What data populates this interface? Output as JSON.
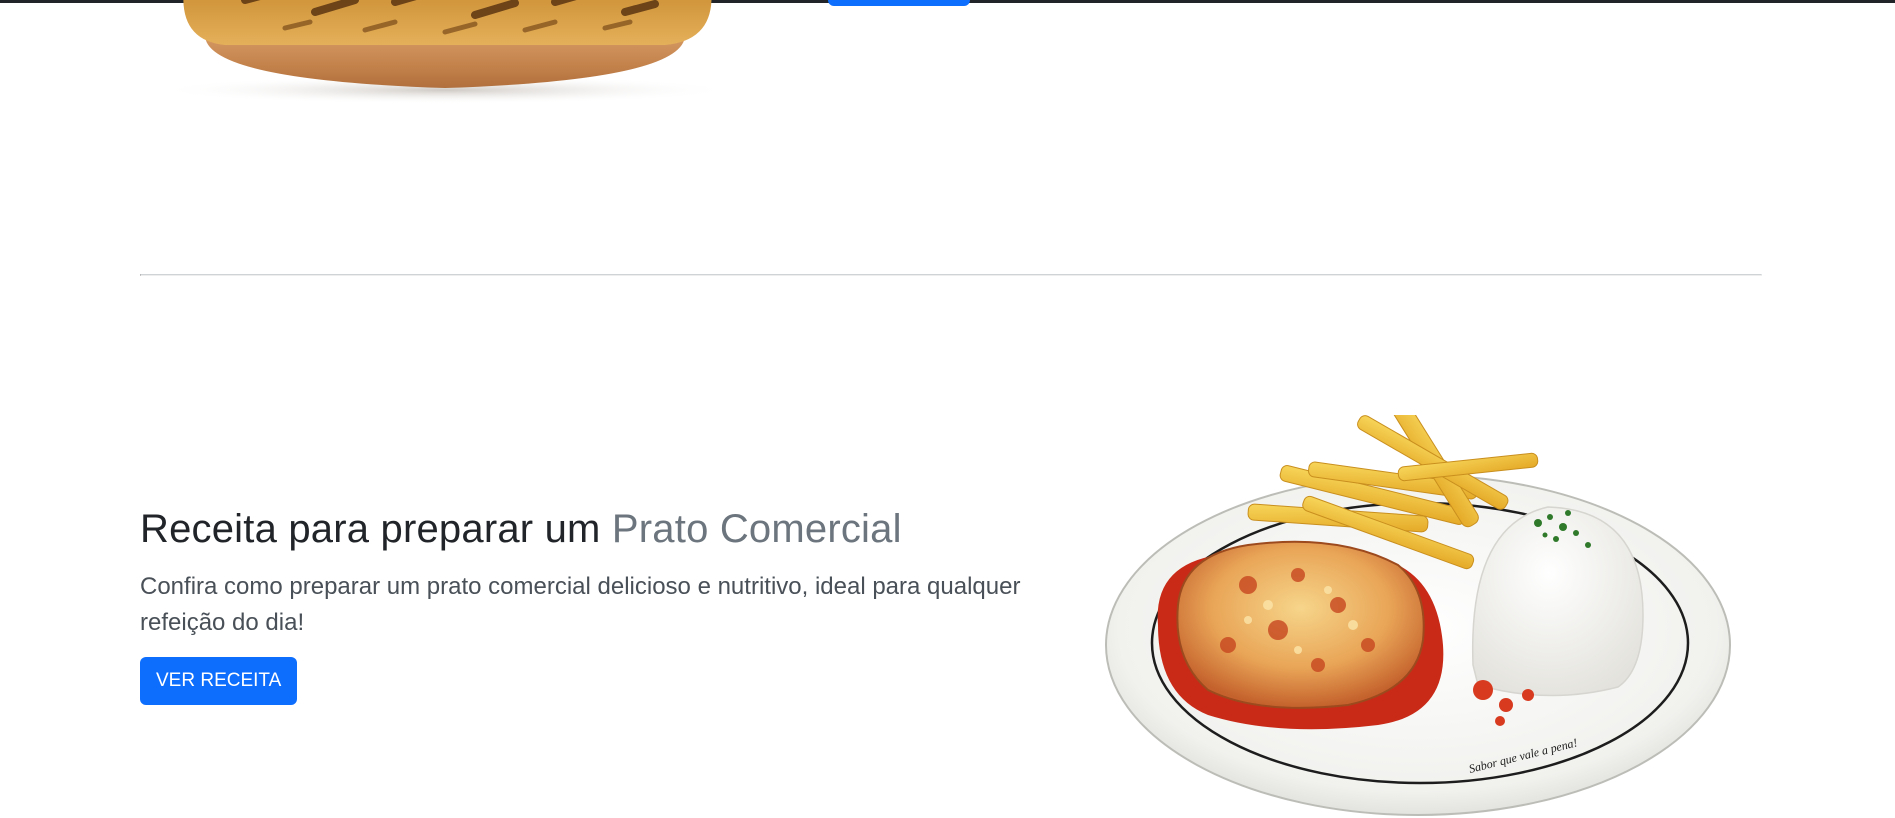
{
  "feature": {
    "heading_main": "Receita para preparar um ",
    "heading_muted": "Prato Comercial",
    "lead": "Confira como preparar um prato comercial delicioso e nutritivo, ideal para qualquer refeição do dia!",
    "button_label": "VER RECEITA"
  },
  "dish_image": {
    "plate_text": "Sabor que vale a pena!"
  },
  "colors": {
    "primary": "#0d6efd",
    "heading": "#212529",
    "muted": "#6c757d",
    "divider": "#d0d3d6"
  }
}
